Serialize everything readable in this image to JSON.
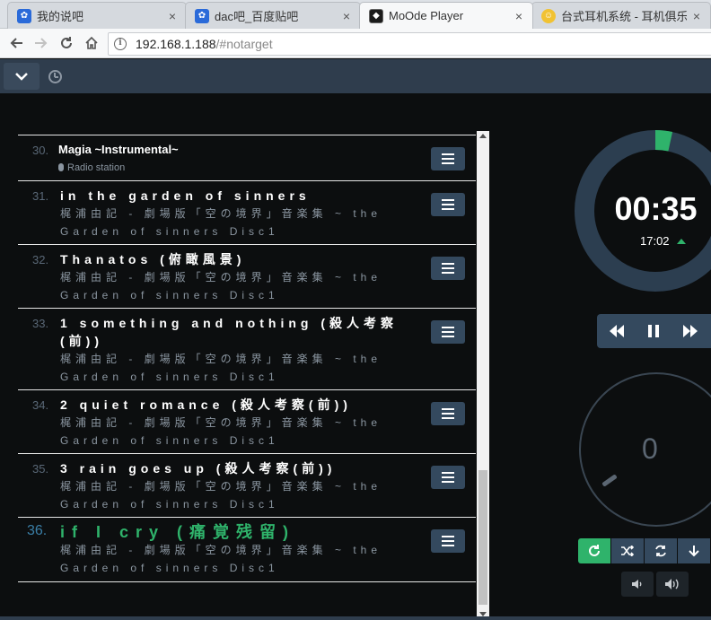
{
  "browser": {
    "tabs": [
      {
        "title": "我的说吧",
        "icon": "baidu-paw"
      },
      {
        "title": "dac吧_百度贴吧",
        "icon": "baidu-paw"
      },
      {
        "title": "MoOde Player",
        "icon": "moode-logo"
      },
      {
        "title": "台式耳机系统 - 耳机俱乐",
        "icon": "ear-club"
      }
    ],
    "url_host": "192.168.1.188",
    "url_path": "/#notarget"
  },
  "playlist": [
    {
      "num": "30.",
      "title": "Magia ~Instrumental~",
      "sub": "Radio station",
      "radio": true
    },
    {
      "num": "31.",
      "title": "in the garden of sinners",
      "sub": "梶浦由記 - 劇場版「空の境界」音楽集 ~ the Garden of sinners Disc1"
    },
    {
      "num": "32.",
      "title": "Thanatos (俯瞰風景)",
      "sub": "梶浦由記 - 劇場版「空の境界」音楽集 ~ the Garden of sinners Disc1"
    },
    {
      "num": "33.",
      "title": "1 something and nothing (殺人考察(前))",
      "sub": "梶浦由記 - 劇場版「空の境界」音楽集 ~ the Garden of sinners Disc1"
    },
    {
      "num": "34.",
      "title": "2 quiet romance (殺人考察(前))",
      "sub": "梶浦由記 - 劇場版「空の境界」音楽集 ~ the Garden of sinners Disc1"
    },
    {
      "num": "35.",
      "title": "3 rain goes up (殺人考察(前))",
      "sub": "梶浦由記 - 劇場版「空の境界」音楽集 ~ the Garden of sinners Disc1"
    },
    {
      "num": "36.",
      "title": "if I cry (痛覚残留)",
      "sub": "梶浦由記 - 劇場版「空の境界」音楽集 ~ the Garden of sinners Disc1",
      "active": true
    }
  ],
  "player": {
    "elapsed": "00:35",
    "total": "17:02",
    "progress": 0.034,
    "volume": "0"
  },
  "colors": {
    "accent": "#2fb36b",
    "panel": "#34495e",
    "bg": "#0c0e0f"
  }
}
